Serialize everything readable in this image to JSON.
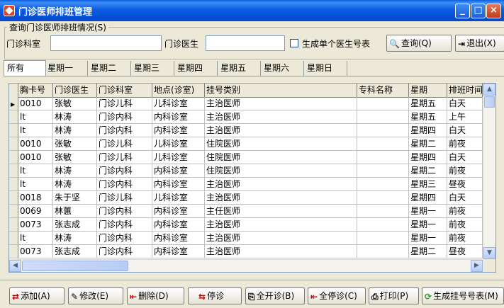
{
  "window": {
    "title": "门诊医师排班管理"
  },
  "query": {
    "group_title": "查询门诊医师排班情况(S)",
    "dept_label": "门诊科室",
    "dept_value": "",
    "doctor_label": "门诊医生",
    "doctor_value": "",
    "checkbox_label": "生成单个医生号表",
    "query_button": "查询(Q)",
    "exit_button": "退出(X)"
  },
  "tabs": [
    "所有",
    "星期一",
    "星期二",
    "星期三",
    "星期四",
    "星期五",
    "星期六",
    "星期日"
  ],
  "table": {
    "columns": [
      "胸卡号",
      "门诊医生",
      "门诊科室",
      "地点(诊室)",
      "挂号类别",
      "专科名称",
      "星期",
      "排班时间"
    ],
    "rows": [
      [
        "0010",
        "张敏",
        "门诊儿科",
        "儿科诊室",
        "主治医师",
        "",
        "星期五",
        "白天"
      ],
      [
        "lt",
        "林涛",
        "门诊内科",
        "内科诊室",
        "主治医师",
        "",
        "星期五",
        "上午"
      ],
      [
        "lt",
        "林涛",
        "门诊内科",
        "内科诊室",
        "主治医师",
        "",
        "星期四",
        "白天"
      ],
      [
        "0010",
        "张敏",
        "门诊儿科",
        "儿科诊室",
        "住院医师",
        "",
        "星期二",
        "前夜"
      ],
      [
        "0010",
        "张敏",
        "门诊儿科",
        "儿科诊室",
        "住院医师",
        "",
        "星期四",
        "白天"
      ],
      [
        "lt",
        "林涛",
        "门诊内科",
        "内科诊室",
        "住院医师",
        "",
        "星期二",
        "前夜"
      ],
      [
        "lt",
        "林涛",
        "门诊内科",
        "内科诊室",
        "主治医师",
        "",
        "星期三",
        "昼夜"
      ],
      [
        "0018",
        "朱于坚",
        "门诊儿科",
        "儿科诊室",
        "主治医师",
        "",
        "星期四",
        "白天"
      ],
      [
        "0069",
        "林蕙",
        "门诊内科",
        "内科诊室",
        "主任医师",
        "",
        "星期一",
        "前夜"
      ],
      [
        "0073",
        "张志成",
        "门诊内科",
        "内科诊室",
        "主治医师",
        "",
        "星期一",
        "前夜"
      ],
      [
        "lt",
        "林涛",
        "门诊内科",
        "内科诊室",
        "主治医师",
        "",
        "星期一",
        "前夜"
      ],
      [
        "0073",
        "张志成",
        "门诊内科",
        "内科诊室",
        "主治医师",
        "",
        "星期二",
        "昼夜"
      ]
    ]
  },
  "actions": {
    "add": "添加(A)",
    "edit": "修改(E)",
    "delete": "删除(D)",
    "stop": "停诊",
    "open_all": "全开诊(B)",
    "stop_all": "全停诊(C)",
    "print": "打印(P)",
    "generate": "生成挂号号表(M)"
  }
}
